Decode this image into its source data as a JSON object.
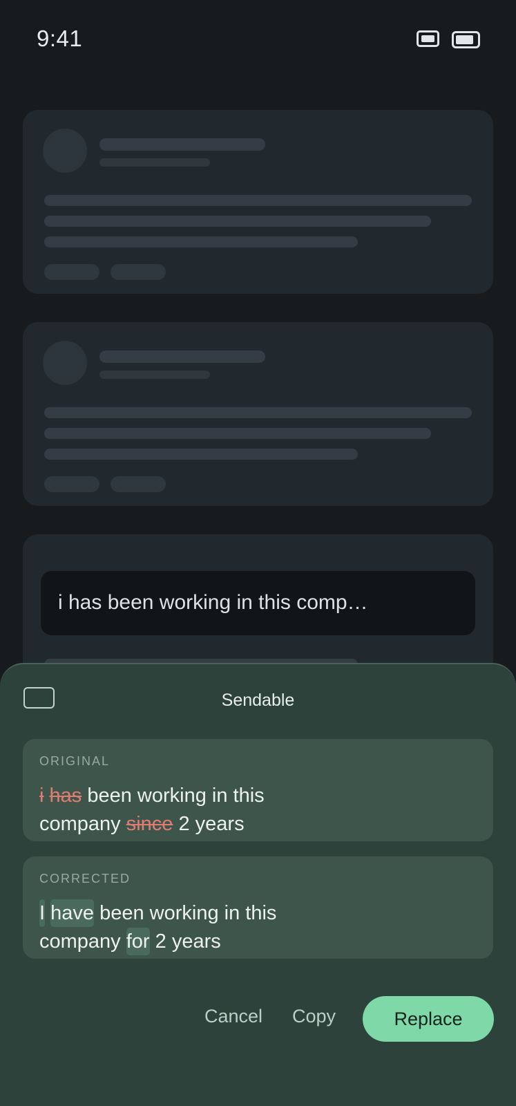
{
  "status_bar": {
    "time": "9:41",
    "icons": [
      "screen-mirror-icon",
      "battery-icon"
    ]
  },
  "compose": {
    "text": "i has been working in this comp…"
  },
  "sheet": {
    "title": "Sendable",
    "icon": "keyboard-icon",
    "original": {
      "label": "ORIGINAL",
      "segments": [
        {
          "text": "i",
          "type": "deleted"
        },
        {
          "text": " ",
          "type": "plain"
        },
        {
          "text": "has",
          "type": "deleted"
        },
        {
          "text": " been working in this",
          "type": "plain"
        },
        {
          "text": "company ",
          "type": "plain"
        },
        {
          "text": "since",
          "type": "deleted"
        },
        {
          "text": " 2 years",
          "type": "plain"
        }
      ]
    },
    "corrected": {
      "label": "CORRECTED",
      "segments": [
        {
          "text": "I",
          "type": "inserted"
        },
        {
          "text": " ",
          "type": "plain"
        },
        {
          "text": "have",
          "type": "inserted"
        },
        {
          "text": " been working in this",
          "type": "plain"
        },
        {
          "text": "company ",
          "type": "plain"
        },
        {
          "text": "for",
          "type": "inserted"
        },
        {
          "text": " 2 years",
          "type": "plain"
        }
      ]
    },
    "actions": {
      "cancel": "Cancel",
      "copy": "Copy",
      "replace": "Replace"
    }
  },
  "colors": {
    "background": "#171b1e",
    "sheet": "#2d423a",
    "accent": "#7fd8a8",
    "deleted": "#e07d72",
    "inserted_highlight": "#4a6a5d"
  }
}
